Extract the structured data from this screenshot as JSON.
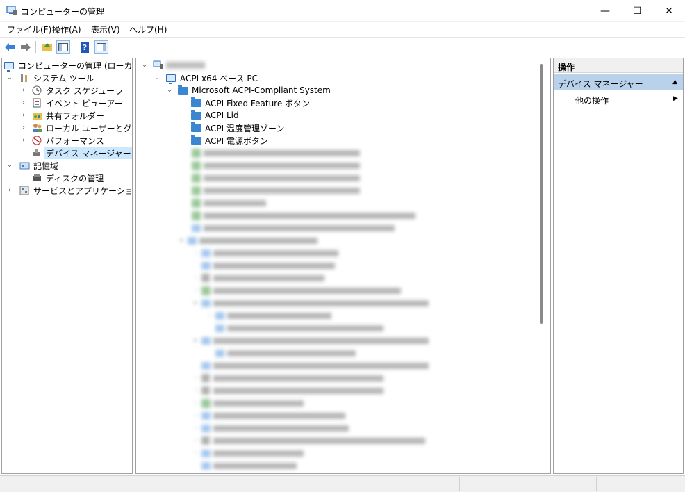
{
  "window": {
    "title": "コンピューターの管理",
    "minimize": "—",
    "maximize": "☐",
    "close": "✕"
  },
  "menu": [
    "ファイル(F)",
    "操作(A)",
    "表示(V)",
    "ヘルプ(H)"
  ],
  "left_tree": [
    {
      "label": "コンピューターの管理 (ローカル)",
      "icon": "computer-management-icon",
      "expander": ""
    },
    {
      "label": "システム ツール",
      "icon": "system-tools-icon",
      "expander": "⌄"
    },
    {
      "label": "タスク スケジューラ",
      "icon": "clock-icon",
      "expander": "›"
    },
    {
      "label": "イベント ビューアー",
      "icon": "event-viewer-icon",
      "expander": "›"
    },
    {
      "label": "共有フォルダー",
      "icon": "shared-folder-icon",
      "expander": "›"
    },
    {
      "label": "ローカル ユーザーとグループ",
      "icon": "users-icon",
      "expander": "›"
    },
    {
      "label": "パフォーマンス",
      "icon": "performance-icon",
      "expander": "›"
    },
    {
      "label": "デバイス マネージャー",
      "icon": "device-manager-icon",
      "expander": ""
    },
    {
      "label": "記憶域",
      "icon": "storage-icon",
      "expander": "⌄"
    },
    {
      "label": "ディスクの管理",
      "icon": "disk-icon",
      "expander": ""
    },
    {
      "label": "サービスとアプリケーション",
      "icon": "services-icon",
      "expander": "›"
    }
  ],
  "device_tree": {
    "root_expander": "⌄",
    "acpi_pc": "ACPI x64 ベース PC",
    "acpi_system": "Microsoft ACPI-Compliant System",
    "children": [
      "ACPI Fixed Feature ボタン",
      "ACPI Lid",
      "ACPI 温度管理ゾーン",
      "ACPI 電源ボタン"
    ]
  },
  "actions": {
    "title": "操作",
    "section": "デバイス マネージャー",
    "section_arrow": "▲",
    "item": "他の操作",
    "item_arrow": "▶"
  }
}
